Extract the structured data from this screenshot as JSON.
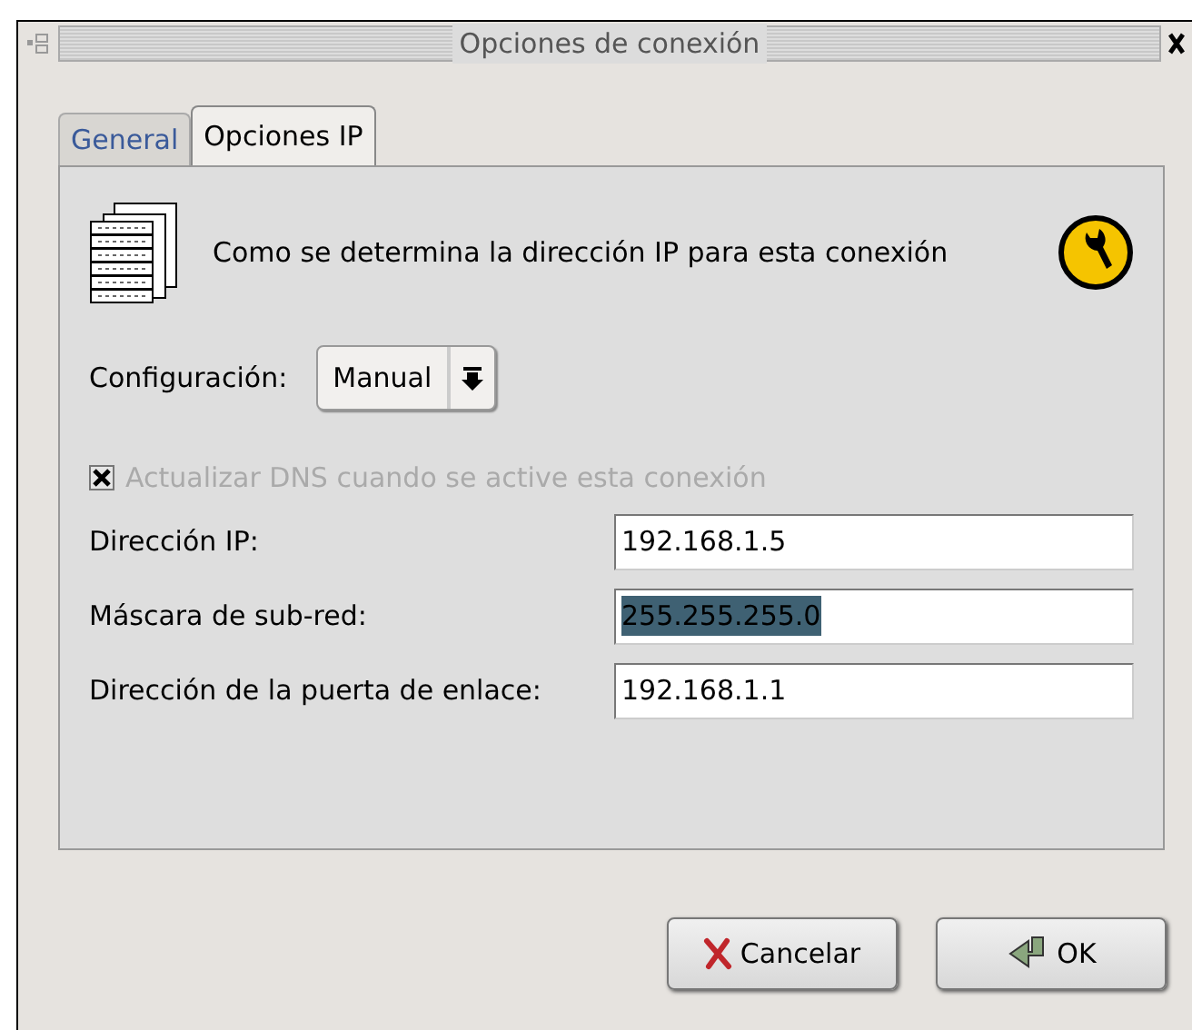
{
  "window": {
    "title": "Opciones de conexión"
  },
  "tabs": [
    {
      "label": "General",
      "selected": false
    },
    {
      "label": "Opciones IP",
      "selected": true
    }
  ],
  "description": "Como se determina la dirección IP para esta conexión",
  "configuration": {
    "label": "Configuración:",
    "value": "Manual"
  },
  "dns_checkbox": {
    "label": "Actualizar DNS cuando se active esta conexión",
    "checked": true,
    "disabled": true
  },
  "fields": [
    {
      "label": "Dirección IP:",
      "value": "192.168.1.5",
      "selected": false
    },
    {
      "label": "Máscara de sub-red:",
      "value": "255.255.255.0",
      "selected": true
    },
    {
      "label": "Dirección de la puerta de enlace:",
      "value": "192.168.1.1",
      "selected": false
    }
  ],
  "buttons": [
    {
      "label": "Cancelar",
      "kind": "cancel"
    },
    {
      "label": "OK",
      "kind": "ok"
    }
  ]
}
